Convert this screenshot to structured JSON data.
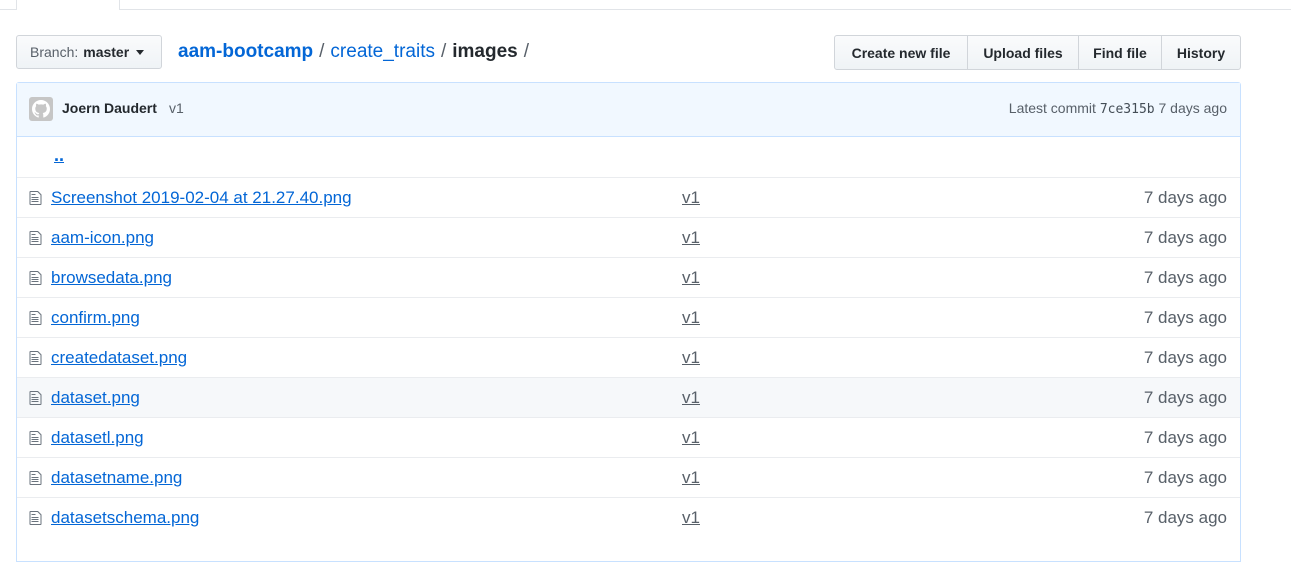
{
  "branch": {
    "prefix": "Branch:",
    "name": "master"
  },
  "breadcrumb": {
    "repo": "aam-bootcamp",
    "folder": "create_traits",
    "current": "images",
    "separator": "/"
  },
  "actions": [
    {
      "label": "Create new file"
    },
    {
      "label": "Upload files"
    },
    {
      "label": "Find file"
    },
    {
      "label": "History"
    }
  ],
  "commit": {
    "author": "Joern Daudert",
    "message": "v1",
    "latest_label": "Latest commit",
    "sha": "7ce315b",
    "age": "7 days ago"
  },
  "up_link": "..",
  "files": [
    {
      "name": "Screenshot 2019-02-04 at 21.27.40.png",
      "message": "v1",
      "age": "7 days ago"
    },
    {
      "name": "aam-icon.png",
      "message": "v1",
      "age": "7 days ago"
    },
    {
      "name": "browsedata.png",
      "message": "v1",
      "age": "7 days ago"
    },
    {
      "name": "confirm.png",
      "message": "v1",
      "age": "7 days ago"
    },
    {
      "name": "createdataset.png",
      "message": "v1",
      "age": "7 days ago"
    },
    {
      "name": "dataset.png",
      "message": "v1",
      "age": "7 days ago"
    },
    {
      "name": "datasetl.png",
      "message": "v1",
      "age": "7 days ago"
    },
    {
      "name": "datasetname.png",
      "message": "v1",
      "age": "7 days ago"
    },
    {
      "name": "datasetschema.png",
      "message": "v1",
      "age": "7 days ago"
    }
  ],
  "highlighted_row": 5,
  "colors": {
    "link": "#0366d6",
    "muted": "#586069",
    "commit_bg": "#f1f8ff",
    "hover_row": "#f6f8fa"
  }
}
